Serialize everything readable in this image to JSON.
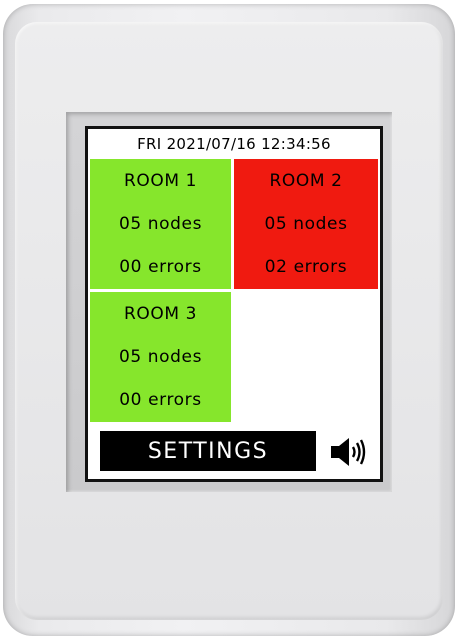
{
  "status_bar": {
    "datetime": "FRI 2021/07/16 12:34:56"
  },
  "rooms": [
    {
      "name": "ROOM 1",
      "nodes": "05 nodes",
      "errors": "00 errors",
      "status": "ok"
    },
    {
      "name": "ROOM 2",
      "nodes": "05 nodes",
      "errors": "02 errors",
      "status": "error"
    },
    {
      "name": "ROOM 3",
      "nodes": "05 nodes",
      "errors": "00 errors",
      "status": "ok"
    }
  ],
  "settings_button": {
    "label": "SETTINGS"
  },
  "speaker": {
    "icon": "speaker-volume-icon"
  },
  "colors": {
    "ok": "#86e62c",
    "error": "#f01a10",
    "button_bg": "#000000",
    "button_text": "#ffffff"
  }
}
